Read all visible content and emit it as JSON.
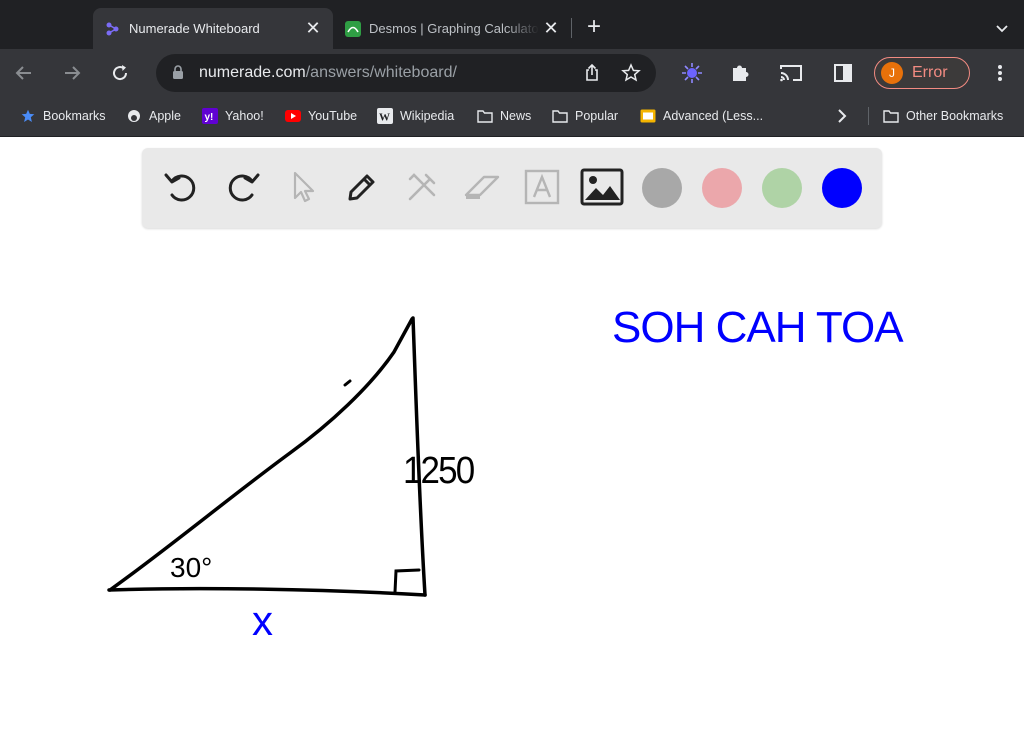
{
  "tabs": [
    {
      "title": "Numerade Whiteboard",
      "active": true,
      "favicon": "numerade-icon"
    },
    {
      "title": "Desmos | Graphing Calculator",
      "active": false,
      "favicon": "desmos-icon"
    }
  ],
  "omnibox": {
    "domain": "numerade.com",
    "path": "/answers/whiteboard/"
  },
  "profile": {
    "initial": "J",
    "status": "Error"
  },
  "bookmarks": [
    {
      "label": "Bookmarks",
      "icon": "star-icon"
    },
    {
      "label": "Apple",
      "icon": "apple-icon"
    },
    {
      "label": "Yahoo!",
      "icon": "yahoo-icon"
    },
    {
      "label": "YouTube",
      "icon": "youtube-icon"
    },
    {
      "label": "Wikipedia",
      "icon": "wikipedia-icon"
    },
    {
      "label": "News",
      "icon": "folder-icon"
    },
    {
      "label": "Popular",
      "icon": "folder-icon"
    },
    {
      "label": "Advanced (Less...",
      "icon": "slides-icon"
    }
  ],
  "other_bookmarks": "Other Bookmarks",
  "whiteboard": {
    "tools": [
      "undo",
      "redo",
      "select",
      "pen",
      "tools",
      "eraser",
      "text",
      "image"
    ],
    "colors": [
      "#a8a8a8",
      "#eba7ab",
      "#afd3a6",
      "#0000ff"
    ],
    "active_color": "#0000ff",
    "drawing": {
      "side_label": "1250",
      "angle_label": "30°",
      "unknown_label": "x",
      "mnemonic": "SOH CAH TOA"
    }
  },
  "colors": {
    "ink": "#000000",
    "blue_ink": "#0000ff",
    "error": "#f28b82"
  }
}
